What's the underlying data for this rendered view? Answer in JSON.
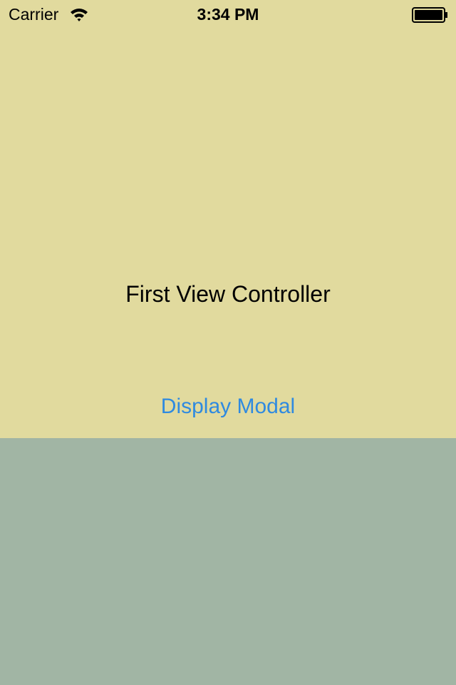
{
  "status_bar": {
    "carrier": "Carrier",
    "time": "3:34 PM",
    "wifi_icon": "wifi-icon",
    "battery_icon": "battery-icon"
  },
  "first_view": {
    "title": "First View Controller",
    "button_label": "Display Modal",
    "background_color": "#E1DA9E",
    "button_color": "#2F8AE0"
  },
  "lower_view": {
    "background_color": "#A1B5A4"
  },
  "colors": {
    "text": "#000000"
  }
}
